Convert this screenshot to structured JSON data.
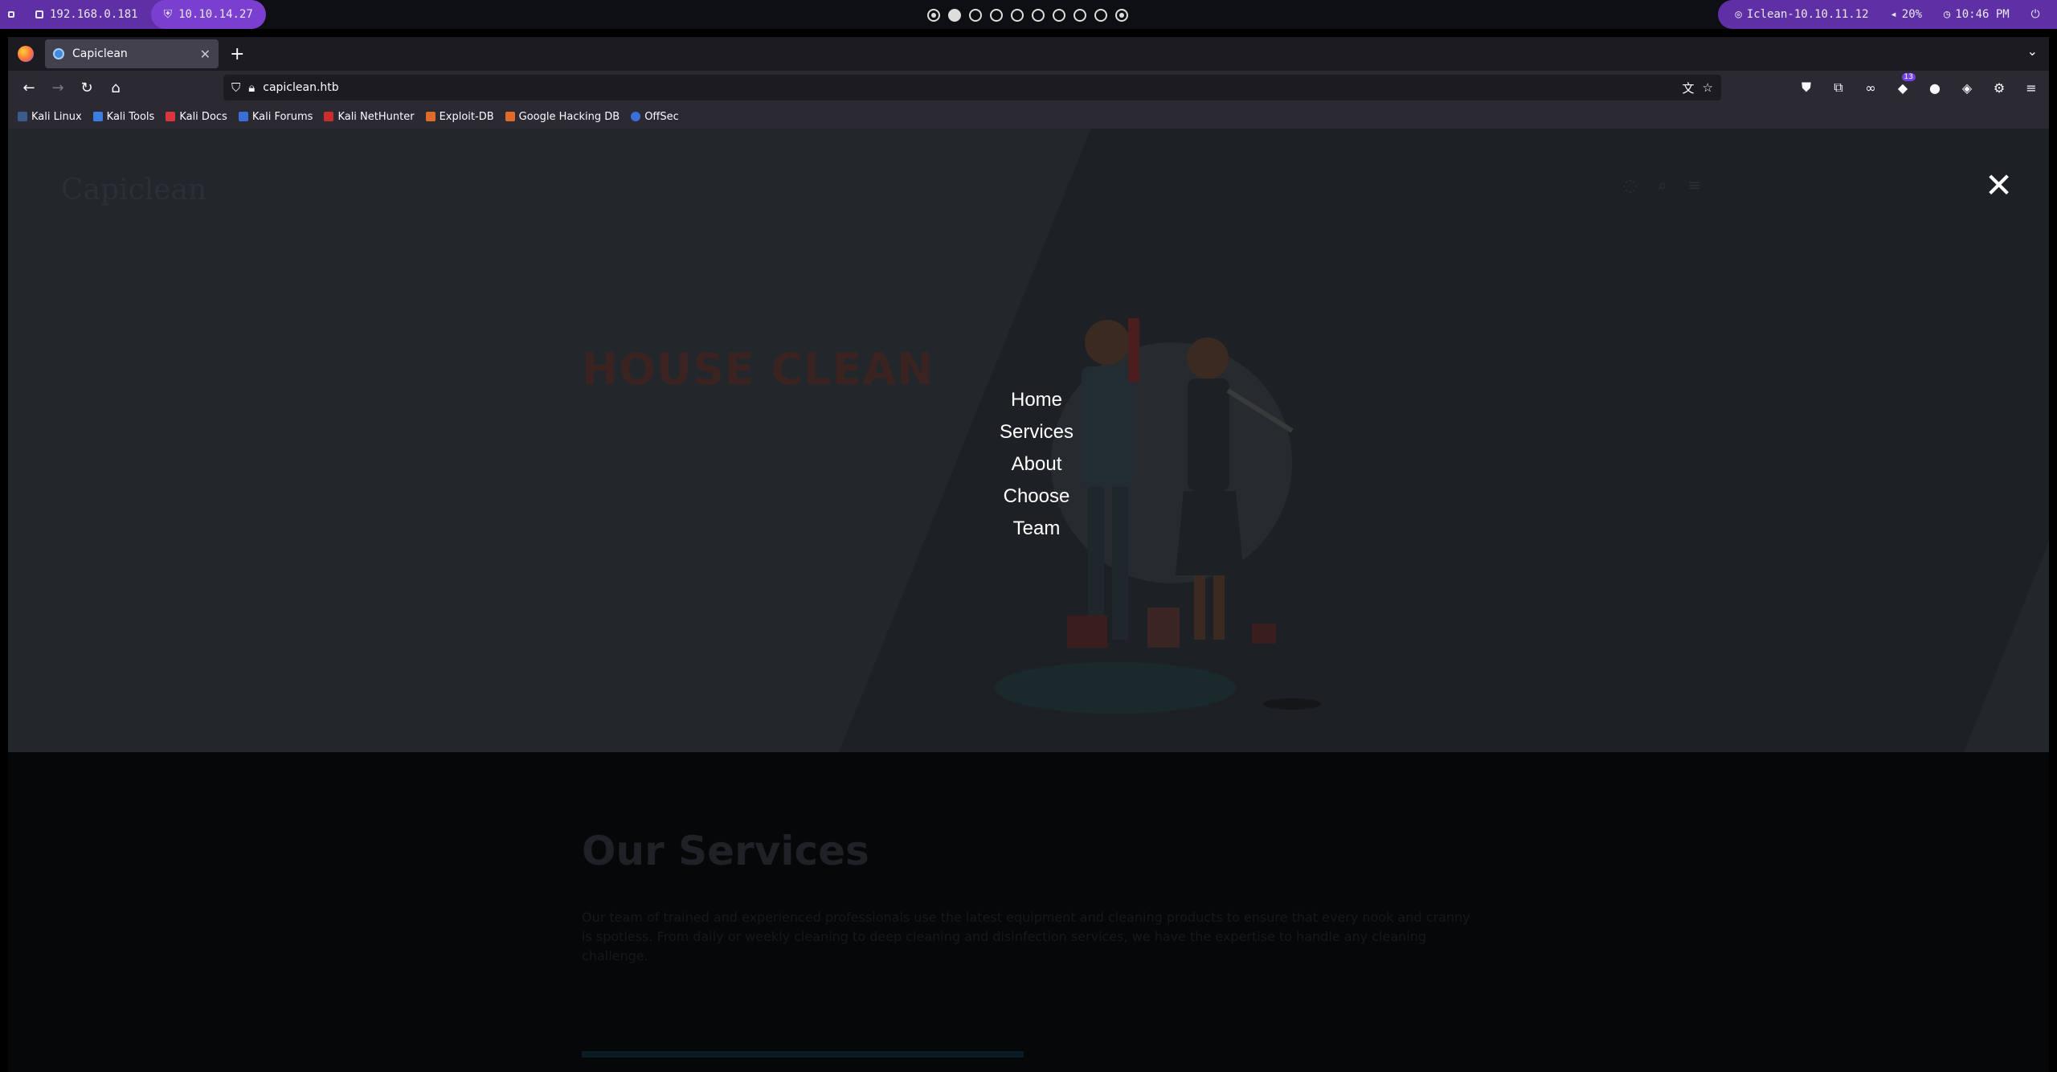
{
  "system_bar": {
    "left_ip": "192.168.0.181",
    "vpn_ip": "10.10.14.27",
    "workspaces": 10,
    "active_workspace": 2,
    "target": "Iclean-10.10.11.12",
    "volume": "20%",
    "clock": "10:46 PM"
  },
  "browser": {
    "tab_title": "Capiclean",
    "url": "capiclean.htb",
    "extension_badge": "13",
    "bookmarks": [
      "Kali Linux",
      "Kali Tools",
      "Kali Docs",
      "Kali Forums",
      "Kali NetHunter",
      "Exploit-DB",
      "Google Hacking DB",
      "OffSec"
    ]
  },
  "page": {
    "logo": "Capiclean",
    "services_title": "Our Services",
    "services_text": "Our team of trained and experienced professionals use the latest equipment and cleaning products to ensure that every nook and cranny is spotless. From daily or weekly cleaning to deep cleaning and disinfection services, we have the expertise to handle any cleaning challenge.",
    "hero_title": "HOUSE CLEAN"
  },
  "overlay": {
    "close": "✕",
    "menu": [
      "Home",
      "Services",
      "About",
      "Choose",
      "Team"
    ]
  },
  "colors": {
    "accent": "#5f2fa6",
    "browser_bg": "#2b2a33"
  }
}
